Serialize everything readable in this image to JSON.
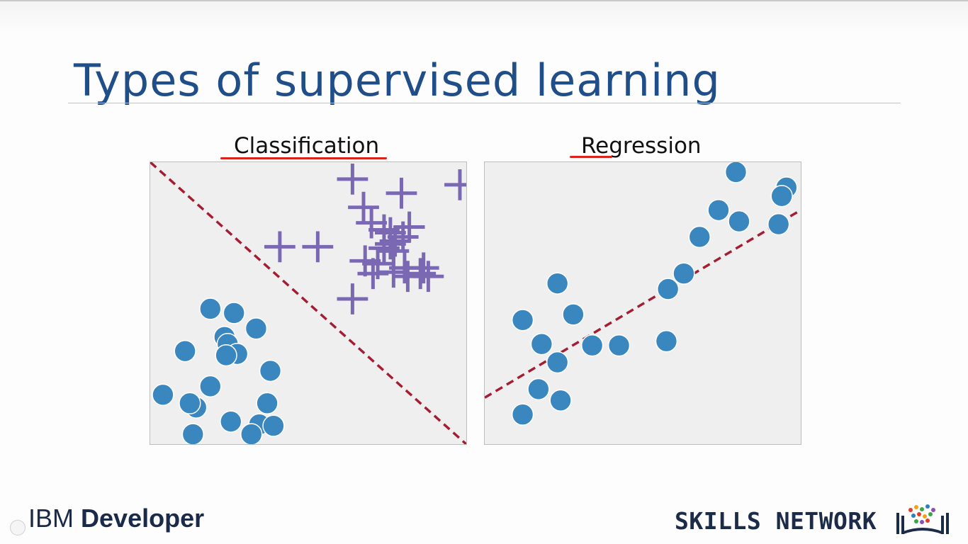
{
  "slide": {
    "title": "Types of supervised learning"
  },
  "colors": {
    "title": "#1f4e89",
    "point": "#3a87c0",
    "cross": "#7b68b3",
    "boundary": "#a31e33",
    "underline": "#d9231b"
  },
  "icons": [
    "skills-network-books-icon"
  ],
  "logos": {
    "ibm_prefix": "IBM",
    "ibm_suffix": "Developer",
    "skills": "SKILLS NETWORK"
  },
  "chart_data": [
    {
      "type": "scatter",
      "title": "Classification",
      "xlabel": "",
      "ylabel": "",
      "xlim": [
        0,
        10
      ],
      "ylim": [
        0,
        10
      ],
      "grid": false,
      "series": [
        {
          "marker": "circle",
          "color": "#3a87c0",
          "points": [
            [
              1.9,
              4.8
            ],
            [
              2.65,
              4.65
            ],
            [
              3.35,
              4.1
            ],
            [
              1.1,
              3.3
            ],
            [
              2.35,
              3.8
            ],
            [
              2.45,
              3.55
            ],
            [
              2.75,
              3.2
            ],
            [
              2.4,
              3.15
            ],
            [
              3.8,
              2.6
            ],
            [
              0.4,
              1.75
            ],
            [
              1.45,
              1.3
            ],
            [
              1.25,
              1.45
            ],
            [
              1.9,
              2.05
            ],
            [
              3.7,
              1.45
            ],
            [
              2.55,
              0.8
            ],
            [
              3.45,
              0.7
            ],
            [
              3.9,
              0.65
            ],
            [
              1.35,
              0.35
            ],
            [
              3.2,
              0.35
            ]
          ]
        },
        {
          "marker": "cross",
          "color": "#7b68b3",
          "points": [
            [
              6.4,
              9.4
            ],
            [
              7.95,
              8.9
            ],
            [
              9.8,
              9.2
            ],
            [
              6.75,
              8.4
            ],
            [
              7.0,
              7.85
            ],
            [
              7.4,
              7.6
            ],
            [
              7.6,
              7.5
            ],
            [
              8.2,
              7.7
            ],
            [
              7.75,
              7.2
            ],
            [
              8.0,
              7.35
            ],
            [
              7.4,
              6.95
            ],
            [
              7.6,
              7.1
            ],
            [
              4.1,
              7.0
            ],
            [
              5.3,
              7.0
            ],
            [
              7.7,
              6.85
            ],
            [
              6.8,
              6.5
            ],
            [
              7.2,
              6.4
            ],
            [
              7.05,
              6.05
            ],
            [
              7.7,
              6.1
            ],
            [
              8.05,
              6.25
            ],
            [
              8.15,
              5.95
            ],
            [
              8.65,
              6.25
            ],
            [
              8.8,
              5.95
            ],
            [
              8.55,
              6.05
            ],
            [
              6.4,
              5.15
            ]
          ]
        }
      ],
      "decision_boundary": {
        "from": [
          0,
          10
        ],
        "to": [
          10,
          0
        ],
        "style": "dashed"
      }
    },
    {
      "type": "scatter",
      "title": "Regression",
      "xlabel": "",
      "ylabel": "",
      "xlim": [
        0,
        10
      ],
      "ylim": [
        0,
        10
      ],
      "grid": false,
      "series": [
        {
          "marker": "circle",
          "color": "#3a87c0",
          "points": [
            [
              7.95,
              9.65
            ],
            [
              9.55,
              9.1
            ],
            [
              9.4,
              8.8
            ],
            [
              7.4,
              8.3
            ],
            [
              8.05,
              7.9
            ],
            [
              9.3,
              7.8
            ],
            [
              6.8,
              7.35
            ],
            [
              6.3,
              6.05
            ],
            [
              5.8,
              5.5
            ],
            [
              2.3,
              5.7
            ],
            [
              1.2,
              4.4
            ],
            [
              2.8,
              4.6
            ],
            [
              1.8,
              3.55
            ],
            [
              3.4,
              3.5
            ],
            [
              4.25,
              3.5
            ],
            [
              5.75,
              3.65
            ],
            [
              2.3,
              2.9
            ],
            [
              1.7,
              1.95
            ],
            [
              2.4,
              1.55
            ],
            [
              1.2,
              1.05
            ]
          ]
        }
      ],
      "regression_line": {
        "from": [
          0,
          1.65
        ],
        "to": [
          10,
          8.3
        ],
        "style": "dashed"
      }
    }
  ]
}
